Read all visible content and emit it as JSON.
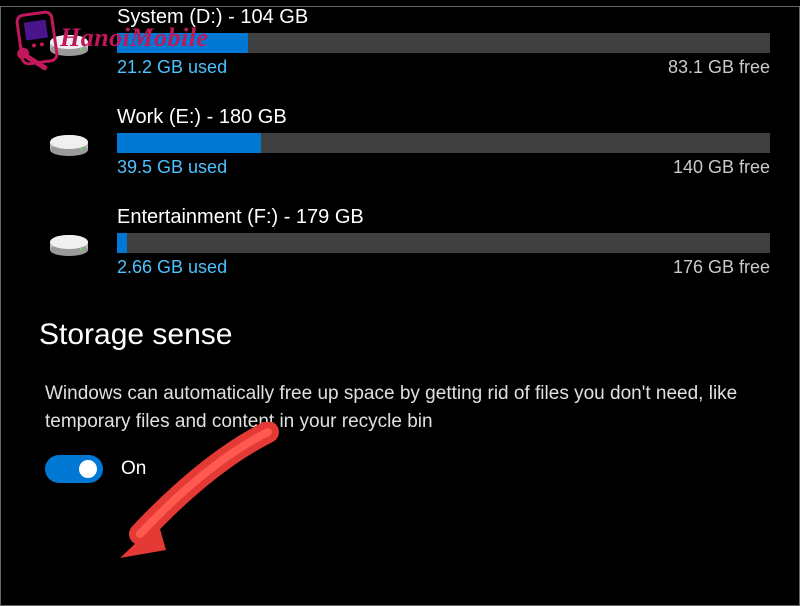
{
  "drives": [
    {
      "title": "System (D:) - 104 GB",
      "used": "21.2 GB used",
      "free": "83.1 GB free",
      "pct": 20
    },
    {
      "title": "Work (E:) - 180 GB",
      "used": "39.5 GB used",
      "free": "140 GB free",
      "pct": 22
    },
    {
      "title": "Entertainment (F:) - 179 GB",
      "used": "2.66 GB used",
      "free": "176 GB free",
      "pct": 1.5
    }
  ],
  "section": {
    "heading": "Storage sense",
    "description": "Windows can automatically free up space by getting rid of files you don't need, like temporary files and content in your recycle bin"
  },
  "toggle": {
    "state": "On"
  },
  "watermark": {
    "text": "HanoiMobile"
  }
}
